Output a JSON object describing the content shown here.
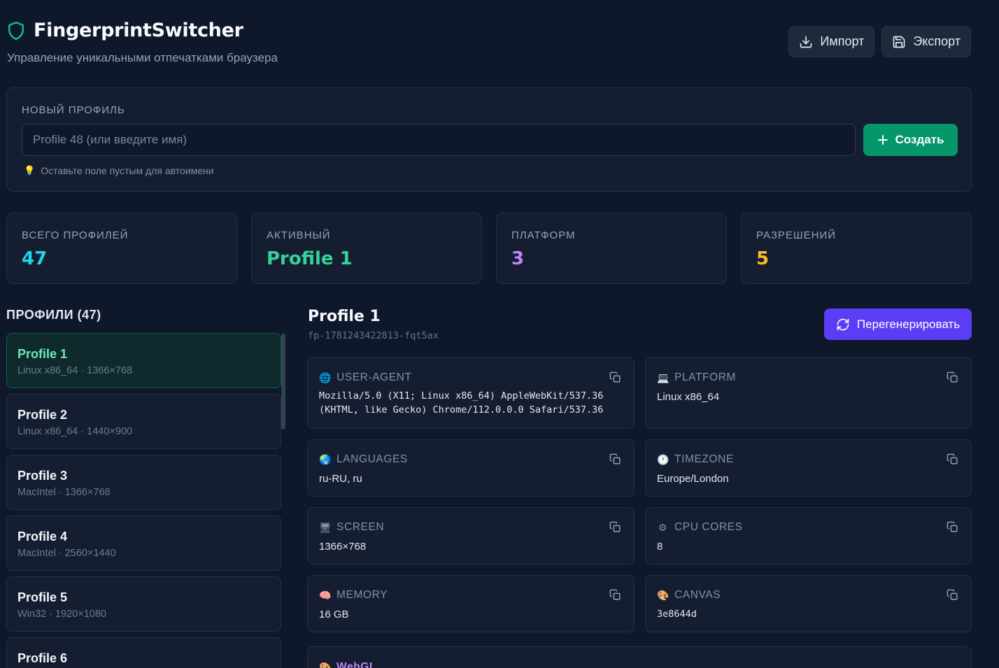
{
  "app": {
    "title": "FingerprintSwitcher",
    "subtitle": "Управление уникальными отпечатками браузера",
    "accent": "#10b981"
  },
  "toolbar": {
    "import_label": "Импорт",
    "export_label": "Экспорт"
  },
  "new_profile": {
    "label": "НОВЫЙ ПРОФИЛЬ",
    "input_value": "",
    "input_placeholder": "Profile 48 (или введите имя)",
    "create_label": "Создать",
    "hint": "Оставьте поле пустым для автоимени"
  },
  "stats": [
    {
      "label": "ВСЕГО ПРОФИЛЕЙ",
      "value": "47",
      "color": "#22d3ee"
    },
    {
      "label": "АКТИВНЫЙ",
      "value": "Profile 1",
      "color": "#34d399"
    },
    {
      "label": "ПЛАТФОРМ",
      "value": "3",
      "color": "#c084fc"
    },
    {
      "label": "РАЗРЕШЕНИЙ",
      "value": "5",
      "color": "#fbbf24"
    }
  ],
  "profiles": {
    "title": "ПРОФИЛИ (47)",
    "items": [
      {
        "name": "Profile 1",
        "meta": "Linux x86_64 · 1366×768",
        "active": true
      },
      {
        "name": "Profile 2",
        "meta": "Linux x86_64 · 1440×900"
      },
      {
        "name": "Profile 3",
        "meta": "MacIntel · 1366×768"
      },
      {
        "name": "Profile 4",
        "meta": "MacIntel · 2560×1440"
      },
      {
        "name": "Profile 5",
        "meta": "Win32 · 1920×1080"
      },
      {
        "name": "Profile 6",
        "meta": ""
      }
    ]
  },
  "detail": {
    "title": "Profile 1",
    "id": "fp-1781243422813-fqt5ax",
    "regenerate_label": "Перегенерировать",
    "fields": {
      "user_agent": {
        "icon": "🌐",
        "label": "USER-AGENT",
        "value_line1": "Mozilla/5.0 (X11; Linux x86_64) AppleWebKit/537.36",
        "value_line2": "(KHTML, like Gecko) Chrome/112.0.0.0 Safari/537.36"
      },
      "platform": {
        "icon": "💻",
        "label": "PLATFORM",
        "value": "Linux x86_64"
      },
      "languages": {
        "icon": "🌏",
        "label": "LANGUAGES",
        "value": "ru-RU, ru"
      },
      "timezone": {
        "icon": "🕐",
        "label": "TIMEZONE",
        "value": "Europe/London"
      },
      "screen": {
        "icon": "🖥",
        "label": "SCREEN",
        "value": "1366×768"
      },
      "cpu": {
        "icon": "⚙",
        "label": "CPU CORES",
        "value": "8"
      },
      "memory": {
        "icon": "🧠",
        "label": "MEMORY",
        "value": "16 GB"
      },
      "canvas": {
        "icon": "🎨",
        "label": "CANVAS",
        "value": "3e8644d"
      },
      "webgl": {
        "icon": "🎨",
        "label": "WebGL"
      }
    }
  }
}
